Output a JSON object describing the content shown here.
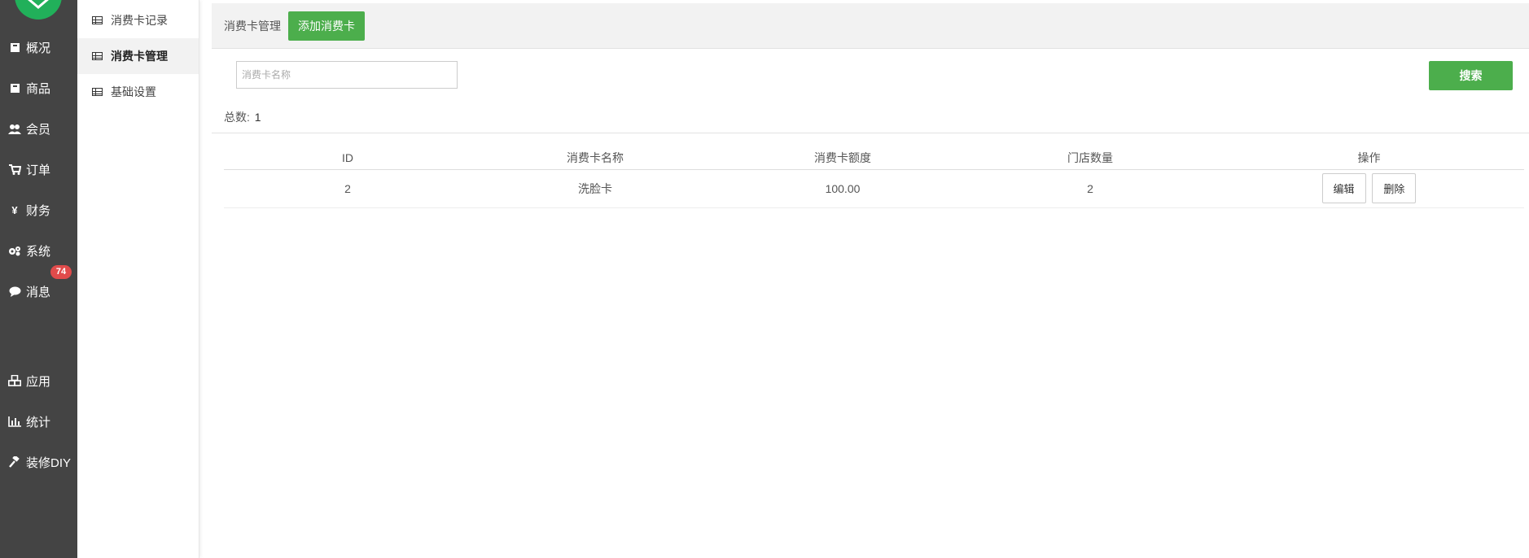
{
  "nav": {
    "items": [
      {
        "label": "概况",
        "icon": "box-icon"
      },
      {
        "label": "商品",
        "icon": "box-icon"
      },
      {
        "label": "会员",
        "icon": "users-icon"
      },
      {
        "label": "订单",
        "icon": "cart-icon"
      },
      {
        "label": "财务",
        "icon": "yen-icon"
      },
      {
        "label": "系统",
        "icon": "gears-icon"
      },
      {
        "label": "消息",
        "icon": "comment-icon",
        "badge": "74"
      },
      {
        "label": "应用",
        "icon": "cubes-icon"
      },
      {
        "label": "统计",
        "icon": "bar-chart-icon"
      },
      {
        "label": "装修DIY",
        "icon": "gavel-icon"
      }
    ],
    "logo_color": "#21b05a"
  },
  "submenu": {
    "items": [
      {
        "label": "消费卡记录",
        "active": false
      },
      {
        "label": "消费卡管理",
        "active": true
      },
      {
        "label": "基础设置",
        "active": false
      }
    ]
  },
  "topbar": {
    "breadcrumb": "消费卡管理",
    "add_button": "添加消费卡"
  },
  "search": {
    "placeholder": "消费卡名称",
    "value": "",
    "button": "搜索"
  },
  "summary": {
    "total_label": "总数:",
    "total_value": "1"
  },
  "table": {
    "headers": [
      "ID",
      "消费卡名称",
      "消费卡额度",
      "门店数量",
      "操作"
    ],
    "rows": [
      {
        "id": "2",
        "name": "洗脸卡",
        "amount": "100.00",
        "stores": "2",
        "edit": "编辑",
        "delete": "删除"
      }
    ]
  },
  "colors": {
    "primary_green": "#4cae4c",
    "sidebar_bg": "#444444",
    "badge_red": "#e04b4b"
  }
}
